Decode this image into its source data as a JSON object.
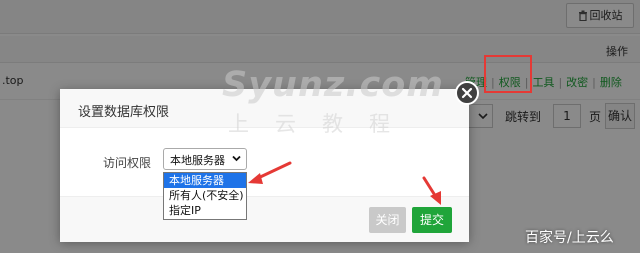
{
  "background": {
    "recycle_button": "回收站",
    "table_header_action": "操作",
    "db_name_fragment": ".top",
    "row_actions": [
      "管理",
      "权限",
      "工具",
      "改密",
      "删除"
    ],
    "pager": {
      "jump_label": "跳转到",
      "page_value": "1",
      "page_unit": "页",
      "confirm": "确认"
    }
  },
  "modal": {
    "title": "设置数据库权限",
    "field_label": "访问权限",
    "selected_value": "本地服务器",
    "options": [
      "本地服务器",
      "所有人(不安全)",
      "指定IP"
    ],
    "close_button": "关闭",
    "submit_button": "提交"
  },
  "watermark": {
    "main": "Syunz.com",
    "sub": "上云教程"
  },
  "credit": "百家号/上云么",
  "colors": {
    "accent_green": "#20a53a",
    "highlight_red": "#e53935",
    "selection_blue": "#1e73e8"
  }
}
